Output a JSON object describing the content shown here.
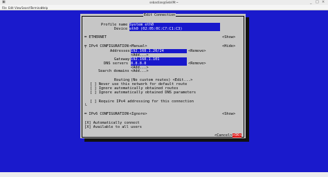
{
  "window": {
    "title": "sebastian@SebVM:~ ",
    "minimize": "_",
    "maximize": "□",
    "close": "×",
    "menu": [
      "File",
      "Edit",
      "View",
      "Search",
      "Terminal",
      "Help"
    ]
  },
  "dialog": {
    "title": "Edit Connection",
    "profile_name_label": "Profile name",
    "profile_name_value": "System eth0",
    "device_label": "Device",
    "device_value": "eth0 (02:05:0C:C7:C1:C3)",
    "ethernet_label": "═ ETHERNET",
    "ethernet_show": "<Show>",
    "ipv4_label": "╤ IPv4 CONFIGURATION",
    "ipv4_mode": "<Manual>",
    "ipv4_hide": "<Hide>",
    "addresses_label": "Addresses",
    "addresses_value": "192.168.1.20/24",
    "addresses_remove": "<Remove>",
    "addresses_add": "<Add...>",
    "gateway_label": "Gateway",
    "gateway_value": "192.168.1.101",
    "dns_label": "DNS servers",
    "dns_value": "8.8.8.8",
    "dns_remove": "<Remove>",
    "dns_add": "<Add...>",
    "search_domains_label": "Search domains",
    "search_domains_add": "<Add...>",
    "routing_label": "Routing",
    "routing_value": "(No custom routes) <Edit...>",
    "chk_default_route": "[ ] Never use this network for default route",
    "chk_ignore_routes": "[ ] Ignore automatically obtained routes",
    "chk_ignore_dns": "[ ] Ignore automatically obtained DNS parameters",
    "chk_require_ipv4": "[ ] Require IPv4 addressing for this connection",
    "ipv4_end": "└",
    "ipv6_label": "═ IPv6 CONFIGURATION",
    "ipv6_mode": "<Ignore>",
    "ipv6_show": "<Show>",
    "chk_autoconnect": "[X] Automatically connect",
    "chk_all_users": "[X] Available to all users",
    "cancel": "<Cancel>",
    "ok": "<OK>"
  }
}
